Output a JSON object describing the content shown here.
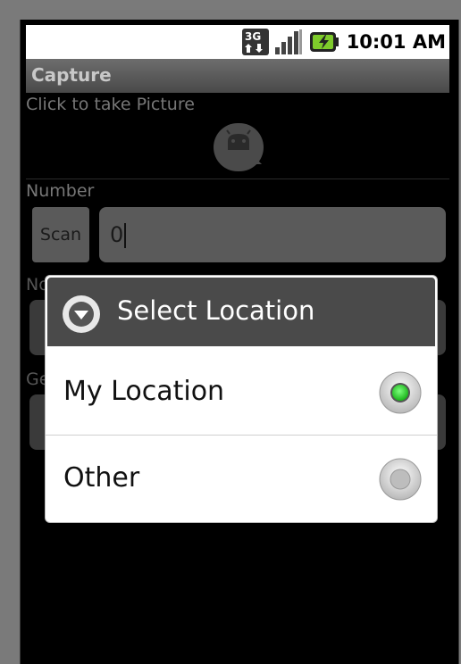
{
  "status_bar": {
    "time": "10:01 AM",
    "network_icon": "3g-data-icon",
    "signal_icon": "signal-strength-icon",
    "battery_icon": "battery-charging-icon"
  },
  "app": {
    "title": "Capture"
  },
  "form": {
    "picture_label": "Click to take Picture",
    "camera_icon": "android-camera-icon",
    "number_label": "Number",
    "scan_label": "Scan",
    "number_value": "0",
    "notes_label": "Notes",
    "geo_label": "Ge"
  },
  "dialog": {
    "title": "Select Location",
    "icon": "dropdown-arrow-icon",
    "options": [
      {
        "label": "My Location",
        "selected": true
      },
      {
        "label": "Other",
        "selected": false
      }
    ]
  },
  "colors": {
    "selected_radio": "#22c022",
    "dialog_header": "#4a4a4a",
    "background": "#000000"
  }
}
